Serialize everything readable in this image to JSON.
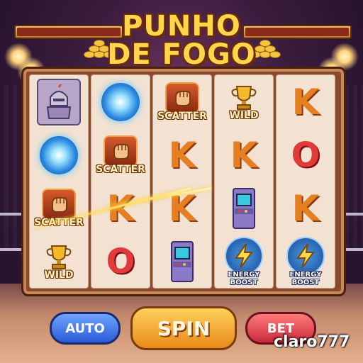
{
  "title": {
    "line1": "PUNHO",
    "line2": "DE FOGO"
  },
  "reels": [
    [
      {
        "kind": "knight",
        "icon": "knight-icon",
        "label": ""
      },
      {
        "kind": "swirl",
        "icon": "swirl-icon",
        "label": ""
      },
      {
        "kind": "fist",
        "icon": "fist-icon",
        "label": "SCATTER"
      },
      {
        "kind": "trophy",
        "icon": "trophy-icon",
        "label": "WILD"
      }
    ],
    [
      {
        "kind": "swirl",
        "icon": "swirl-icon",
        "label": ""
      },
      {
        "kind": "fist",
        "icon": "fist-icon",
        "label": "SCATTER"
      },
      {
        "kind": "letter",
        "icon": "",
        "label": "K"
      },
      {
        "kind": "letter-o",
        "icon": "",
        "label": "O"
      }
    ],
    [
      {
        "kind": "fist",
        "icon": "fist-icon",
        "label": "SCATTER"
      },
      {
        "kind": "letter",
        "icon": "",
        "label": "K"
      },
      {
        "kind": "letter",
        "icon": "",
        "label": "K"
      },
      {
        "kind": "arcade",
        "icon": "arcade-icon",
        "label": ""
      }
    ],
    [
      {
        "kind": "trophy",
        "icon": "trophy-icon",
        "label": "WILD"
      },
      {
        "kind": "letter",
        "icon": "",
        "label": "K"
      },
      {
        "kind": "arcade",
        "icon": "arcade-icon",
        "label": ""
      },
      {
        "kind": "bolt",
        "icon": "lightning-icon",
        "label": "ENERGY BOOST"
      }
    ],
    [
      {
        "kind": "letter",
        "icon": "",
        "label": "K"
      },
      {
        "kind": "letter-o",
        "icon": "",
        "label": "O"
      },
      {
        "kind": "letter",
        "icon": "",
        "label": "K"
      },
      {
        "kind": "bolt",
        "icon": "lightning-icon",
        "label": "ENERGY BOOST"
      }
    ]
  ],
  "buttons": {
    "auto": "AUTO",
    "spin": "SPIN",
    "bet": "BET"
  },
  "watermark": "claro777",
  "colors": {
    "gold": "#ffd64a",
    "frame": "#8a4a2e",
    "spin": "#f5a623",
    "auto": "#3a6ee0",
    "bet": "#e0404a"
  }
}
